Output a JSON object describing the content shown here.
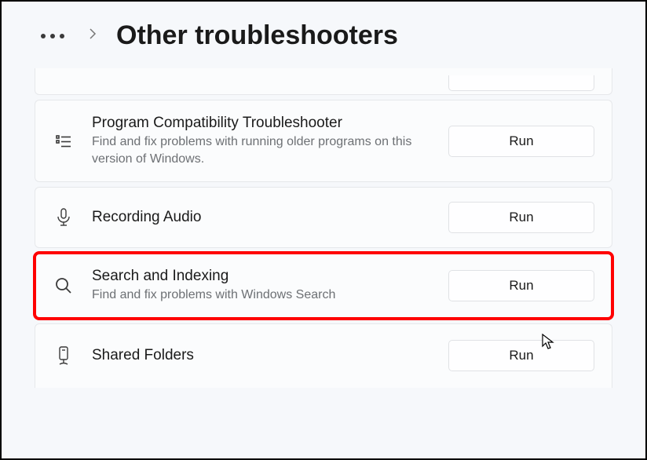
{
  "header": {
    "title": "Other troubleshooters"
  },
  "items": [
    {
      "title": "Program Compatibility Troubleshooter",
      "desc": "Find and fix problems with running older programs on this version of Windows.",
      "button": "Run"
    },
    {
      "title": "Recording Audio",
      "desc": "",
      "button": "Run"
    },
    {
      "title": "Search and Indexing",
      "desc": "Find and fix problems with Windows Search",
      "button": "Run"
    },
    {
      "title": "Shared Folders",
      "desc": "",
      "button": "Run"
    }
  ]
}
